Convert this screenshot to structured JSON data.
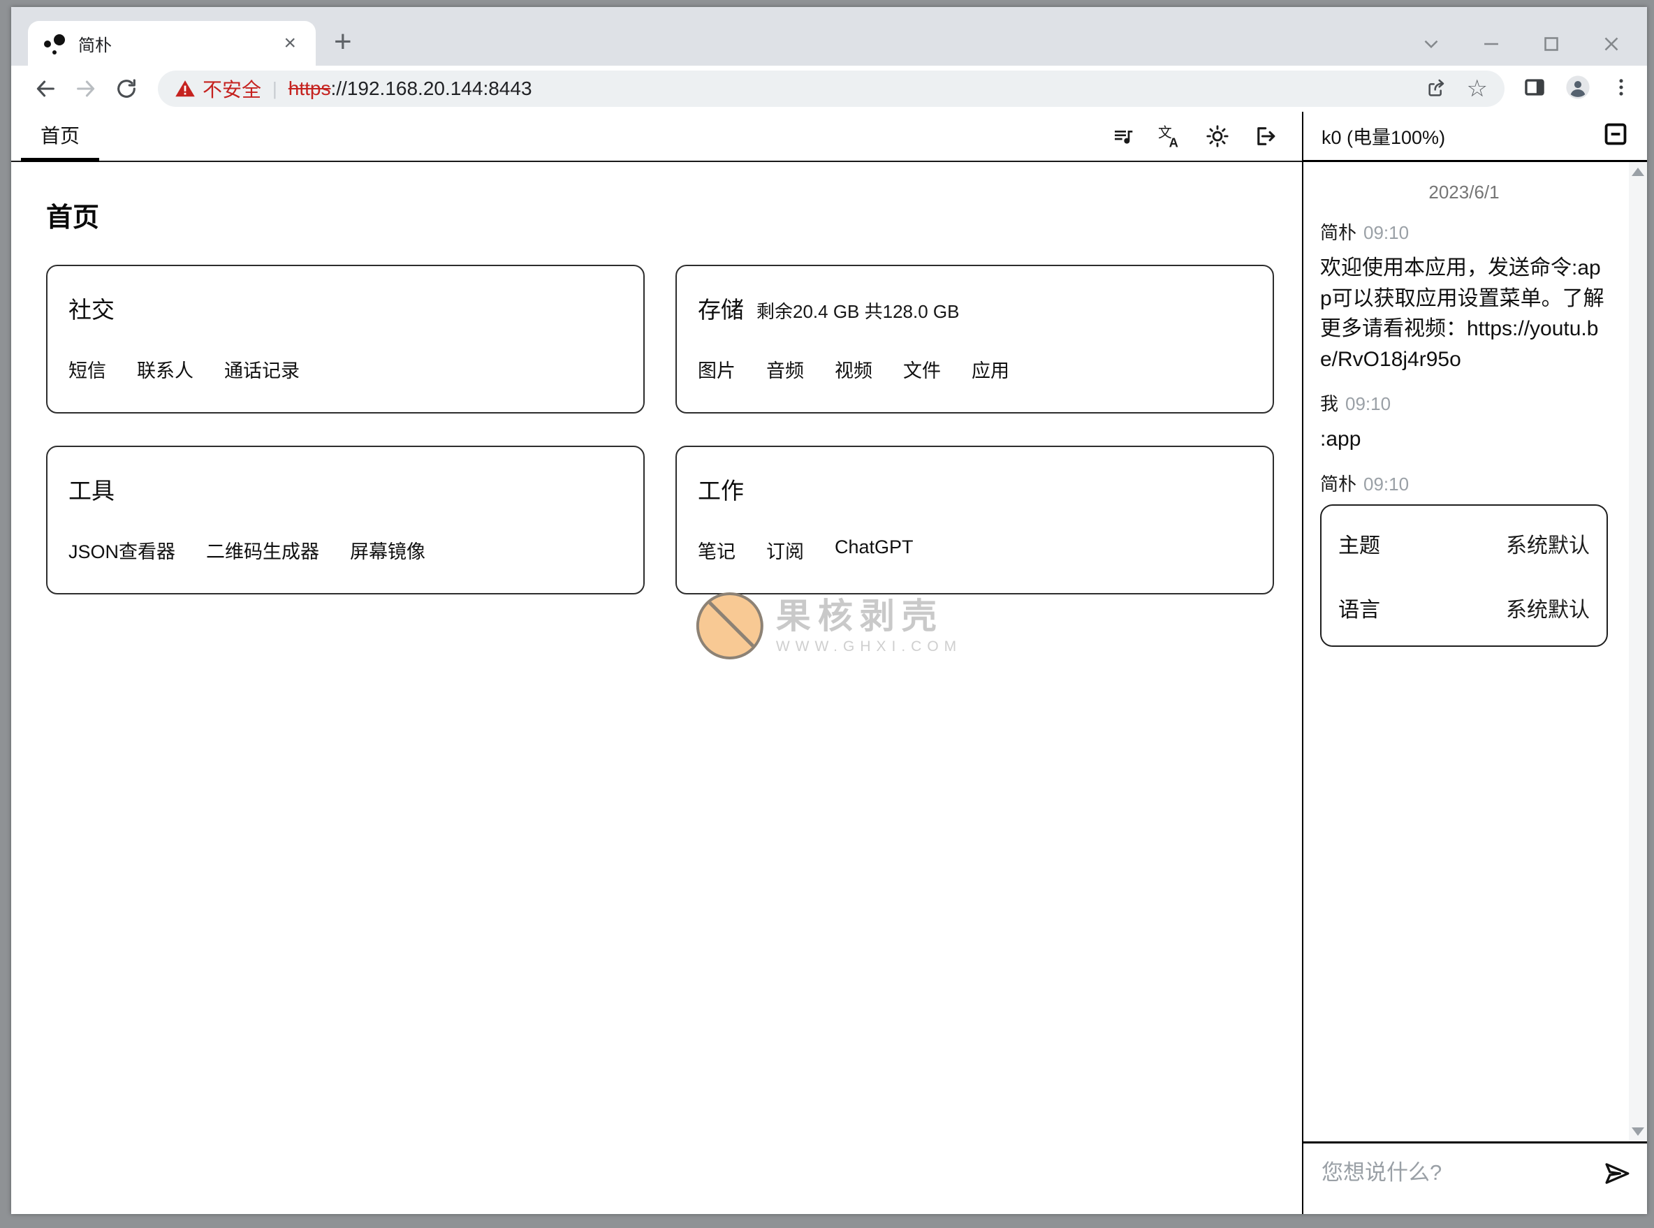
{
  "colors": {
    "warning_red": "#c5221f",
    "watermark_circle": "#f8c994",
    "frame_gray": "#8f9295",
    "tabstrip_gray": "#dee1e6"
  },
  "browser": {
    "tab_title": "简朴",
    "tab_close": "×",
    "new_tab": "+",
    "address": {
      "warning": "不安全",
      "separator": "|",
      "scheme": "https",
      "host": "://192.168.20.144:8443"
    },
    "bookmark_star": "☆"
  },
  "app": {
    "header_tab": "首页",
    "page_title": "首页",
    "cards": [
      {
        "title": "社交",
        "subtitle": "",
        "links": [
          "短信",
          "联系人",
          "通话记录"
        ]
      },
      {
        "title": "存储",
        "subtitle": "剩余20.4 GB 共128.0 GB",
        "links": [
          "图片",
          "音频",
          "视频",
          "文件",
          "应用"
        ]
      },
      {
        "title": "工具",
        "subtitle": "",
        "links": [
          "JSON查看器",
          "二维码生成器",
          "屏幕镜像"
        ]
      },
      {
        "title": "工作",
        "subtitle": "",
        "links": [
          "笔记",
          "订阅",
          "ChatGPT"
        ]
      }
    ]
  },
  "watermark": {
    "line1": "果核剥壳",
    "line2": "WWW.GHXI.COM"
  },
  "chat": {
    "header_title": "k0 (电量100%)",
    "date": "2023/6/1",
    "messages": [
      {
        "sender": "简朴",
        "time": "09:10",
        "text": "欢迎使用本应用，发送命令:app可以获取应用设置菜单。了解更多请看视频：https://youtu.be/RvO18j4r95o"
      },
      {
        "sender": "我",
        "time": "09:10",
        "text": ":app"
      },
      {
        "sender": "简朴",
        "time": "09:10",
        "menu": [
          {
            "label": "主题",
            "value": "系统默认"
          },
          {
            "label": "语言",
            "value": "系统默认"
          }
        ]
      }
    ],
    "input_placeholder": "您想说什么?"
  }
}
